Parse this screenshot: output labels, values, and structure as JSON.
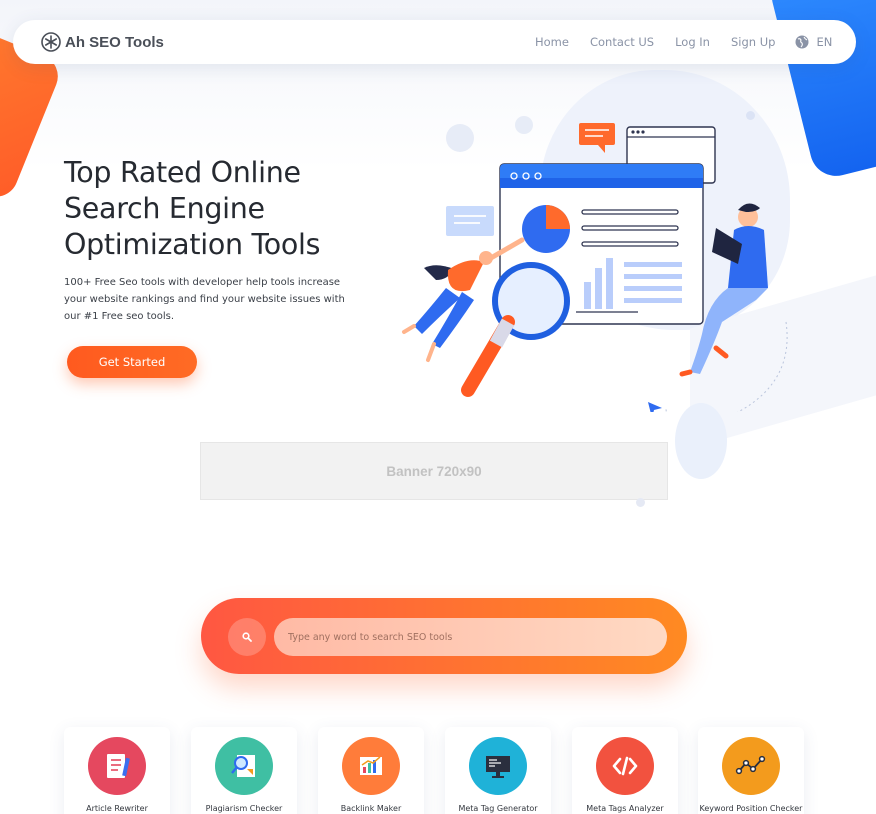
{
  "nav": {
    "brand": "Ah SEO Tools",
    "brand_icon": "snowflake-logo-icon",
    "links": [
      "Home",
      "Contact US",
      "Log In",
      "Sign Up"
    ],
    "language": "EN",
    "language_icon": "globe-icon"
  },
  "hero": {
    "title": "Top Rated Online Search Engine Optimization Tools",
    "description": "100+ Free Seo tools with developer help tools increase your website rankings and find your website issues with our #1 Free seo tools.",
    "cta_label": "Get Started",
    "illustration": "seo-analytics-illustration"
  },
  "banner": {
    "text": "Banner  720x90"
  },
  "search": {
    "placeholder": "Type any word to search SEO tools",
    "value": "",
    "icon": "search-icon"
  },
  "tools": [
    {
      "label": "Article Rewriter",
      "icon": "article-document-icon",
      "color": "#e5485f"
    },
    {
      "label": "Plagiarism Checker",
      "icon": "magnifier-report-icon",
      "color": "#3fbfa3"
    },
    {
      "label": "Backlink Maker",
      "icon": "bar-chart-icon",
      "color": "#ff7c3a"
    },
    {
      "label": "Meta Tag Generator",
      "icon": "monitor-code-icon",
      "color": "#1fb2d8"
    },
    {
      "label": "Meta Tags Analyzer",
      "icon": "code-brackets-icon",
      "color": "#f2523f"
    },
    {
      "label": "Keyword Position Checker",
      "icon": "line-chart-icon",
      "color": "#f39b1d"
    }
  ],
  "colors": {
    "accent_orange": "#ff5a1f",
    "accent_blue": "#1f6bf0",
    "nav_text": "#8a93a6"
  }
}
